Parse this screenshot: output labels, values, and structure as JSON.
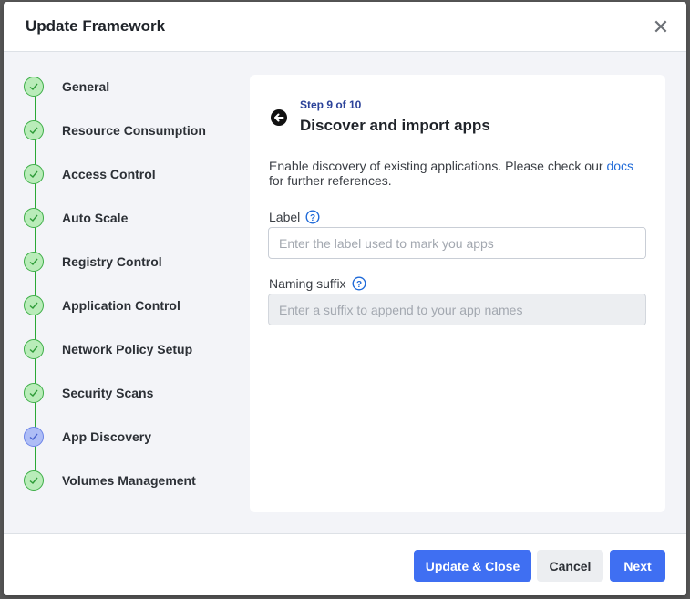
{
  "modal": {
    "title": "Update Framework",
    "close_icon": "close-icon"
  },
  "stepper": {
    "steps": [
      {
        "label": "General",
        "status": "complete"
      },
      {
        "label": "Resource Consumption",
        "status": "complete"
      },
      {
        "label": "Access Control",
        "status": "complete"
      },
      {
        "label": "Auto Scale",
        "status": "complete"
      },
      {
        "label": "Registry Control",
        "status": "complete"
      },
      {
        "label": "Application Control",
        "status": "complete"
      },
      {
        "label": "Network Policy Setup",
        "status": "complete"
      },
      {
        "label": "Security Scans",
        "status": "complete"
      },
      {
        "label": "App Discovery",
        "status": "active"
      },
      {
        "label": "Volumes Management",
        "status": "complete"
      }
    ]
  },
  "content": {
    "step_count": "Step 9 of 10",
    "title": "Discover and import apps",
    "description": "Enable discovery of existing applications. Please check our ",
    "docs_link": "docs",
    "description_end": "for further references.",
    "label_field": {
      "label": "Label",
      "value": "",
      "placeholder": "Enter the label used to mark you apps"
    },
    "suffix_field": {
      "label": "Naming suffix",
      "value": "",
      "placeholder": "Enter a suffix to append to your app names"
    }
  },
  "footer": {
    "update_close": "Update & Close",
    "cancel": "Cancel",
    "next": "Next"
  },
  "colors": {
    "primary": "#3f6ff2",
    "complete": "#3dae47",
    "active": "#6c84e8",
    "link": "#1f6ad8"
  }
}
